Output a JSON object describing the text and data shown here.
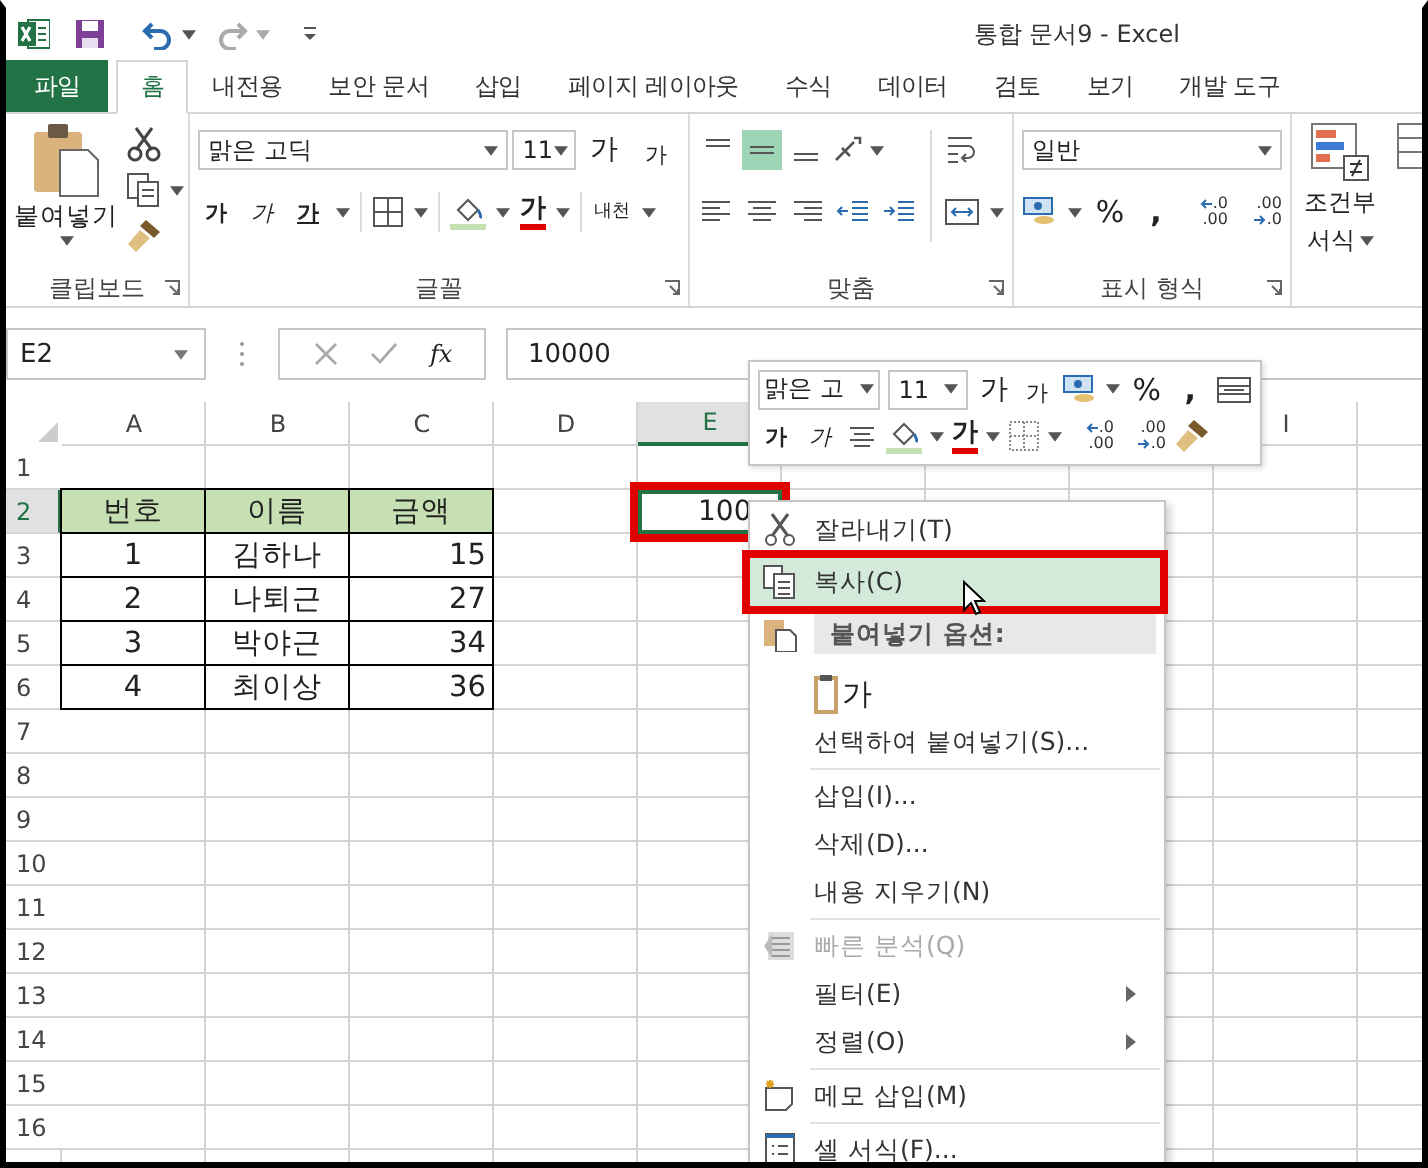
{
  "window": {
    "title": "통합 문서9 - Excel"
  },
  "tabs": [
    {
      "label": "파일",
      "kind": "file",
      "selected": false
    },
    {
      "label": "홈",
      "kind": "tab",
      "selected": true
    },
    {
      "label": "내전용",
      "kind": "tab",
      "selected": false
    },
    {
      "label": "보안 문서",
      "kind": "tab",
      "selected": false
    },
    {
      "label": "삽입",
      "kind": "tab",
      "selected": false
    },
    {
      "label": "페이지 레이아웃",
      "kind": "tab",
      "selected": false
    },
    {
      "label": "수식",
      "kind": "tab",
      "selected": false
    },
    {
      "label": "데이터",
      "kind": "tab",
      "selected": false
    },
    {
      "label": "검토",
      "kind": "tab",
      "selected": false
    },
    {
      "label": "보기",
      "kind": "tab",
      "selected": false
    },
    {
      "label": "개발 도구",
      "kind": "tab",
      "selected": false
    }
  ],
  "ribbon": {
    "clipboard": {
      "label": "클립보드",
      "paste": "붙여넣기"
    },
    "font": {
      "label": "글꼴",
      "font_name": "맑은 고딕",
      "font_size": "11",
      "size_buttons": [
        {
          "label": "가",
          "kind": "grow"
        },
        {
          "label": "가",
          "kind": "shrink"
        }
      ],
      "style_buttons": [
        {
          "label": "가",
          "kind": "bold"
        },
        {
          "label": "가",
          "kind": "italic"
        },
        {
          "label": "가",
          "kind": "underline"
        }
      ],
      "font_color": "가",
      "phonetic": "내천"
    },
    "alignment": {
      "label": "맞춤",
      "vertical": [
        {
          "kind": "top",
          "selected": false
        },
        {
          "kind": "middle",
          "selected": true
        },
        {
          "kind": "bottom",
          "selected": false
        }
      ]
    },
    "number": {
      "label": "표시 형식",
      "format": "일반",
      "percent": "%",
      "comma": ",",
      "decimals": [
        {
          "kind": "increase",
          "top": ".0",
          "bottom": ".00"
        },
        {
          "kind": "decrease",
          "top": ".00",
          "bottom": ".0"
        }
      ]
    },
    "styles": {
      "conditional": [
        "조건부",
        "서식"
      ]
    }
  },
  "formula_bar": {
    "name_box": "E2",
    "fx": "fx",
    "value": "10000"
  },
  "sheet": {
    "columns": [
      {
        "label": "A",
        "selected": false
      },
      {
        "label": "B",
        "selected": false
      },
      {
        "label": "C",
        "selected": false
      },
      {
        "label": "D",
        "selected": false
      },
      {
        "label": "E",
        "selected": true
      },
      {
        "label": "I",
        "selected": false
      }
    ],
    "rows": [
      {
        "number": "1",
        "selected": false,
        "cells": []
      },
      {
        "number": "2",
        "selected": true,
        "active_value": "100",
        "cells": [
          {
            "text": "번호",
            "kind": "heading"
          },
          {
            "text": "이름",
            "kind": "heading"
          },
          {
            "text": "금액",
            "kind": "heading"
          }
        ]
      },
      {
        "number": "3",
        "selected": false,
        "cells": [
          {
            "text": "1",
            "kind": "index"
          },
          {
            "text": "김하나",
            "kind": "text"
          },
          {
            "text": "15",
            "kind": "number"
          }
        ]
      },
      {
        "number": "4",
        "selected": false,
        "cells": [
          {
            "text": "2",
            "kind": "index"
          },
          {
            "text": "나퇴근",
            "kind": "text"
          },
          {
            "text": "27",
            "kind": "number"
          }
        ]
      },
      {
        "number": "5",
        "selected": false,
        "cells": [
          {
            "text": "3",
            "kind": "index"
          },
          {
            "text": "박야근",
            "kind": "text"
          },
          {
            "text": "34",
            "kind": "number"
          }
        ]
      },
      {
        "number": "6",
        "selected": false,
        "cells": [
          {
            "text": "4",
            "kind": "index"
          },
          {
            "text": "최이상",
            "kind": "text"
          },
          {
            "text": "36",
            "kind": "number"
          }
        ]
      },
      {
        "number": "7",
        "selected": false,
        "cells": []
      },
      {
        "number": "8",
        "selected": false,
        "cells": []
      },
      {
        "number": "9",
        "selected": false,
        "cells": []
      },
      {
        "number": "10",
        "selected": false,
        "cells": []
      },
      {
        "number": "11",
        "selected": false,
        "cells": []
      },
      {
        "number": "12",
        "selected": false,
        "cells": []
      },
      {
        "number": "13",
        "selected": false,
        "cells": []
      },
      {
        "number": "14",
        "selected": false,
        "cells": []
      },
      {
        "number": "15",
        "selected": false,
        "cells": []
      },
      {
        "number": "16",
        "selected": false,
        "cells": []
      }
    ]
  },
  "mini_toolbar": {
    "font_name": "맑은 고",
    "font_size": "11",
    "size_buttons": [
      {
        "label": "가",
        "kind": "grow"
      },
      {
        "label": "가",
        "kind": "shrink"
      }
    ],
    "percent": "%",
    "comma": ",",
    "style_buttons": [
      {
        "label": "가",
        "kind": "bold"
      },
      {
        "label": "가",
        "kind": "italic"
      }
    ],
    "font_color": "가",
    "decimals": [
      {
        "kind": "increase",
        "top": ".0",
        "bottom": ".00"
      },
      {
        "kind": "decrease",
        "top": ".00",
        "bottom": ".0"
      }
    ]
  },
  "context_menu": [
    {
      "kind": "cut",
      "label": "잘라내기(T)",
      "selected": false,
      "disabled": false
    },
    {
      "kind": "copy",
      "label": "복사(C)",
      "selected": true,
      "disabled": false
    },
    {
      "kind": "section",
      "label": "붙여넣기 옵션:"
    },
    {
      "kind": "paste",
      "label": "가"
    },
    {
      "kind": "item",
      "label": "선택하여 붙여넣기(S)...",
      "selected": false,
      "disabled": false
    },
    {
      "kind": "separator"
    },
    {
      "kind": "item",
      "label": "삽입(I)...",
      "selected": false,
      "disabled": false
    },
    {
      "kind": "item",
      "label": "삭제(D)...",
      "selected": false,
      "disabled": false
    },
    {
      "kind": "item",
      "label": "내용 지우기(N)",
      "selected": false,
      "disabled": false
    },
    {
      "kind": "separator"
    },
    {
      "kind": "analysis",
      "label": "빠른 분석(Q)",
      "selected": false,
      "disabled": true
    },
    {
      "kind": "submenu",
      "label": "필터(E)",
      "selected": false,
      "disabled": false
    },
    {
      "kind": "submenu",
      "label": "정렬(O)",
      "selected": false,
      "disabled": false
    },
    {
      "kind": "separator"
    },
    {
      "kind": "comment",
      "label": "메모 삽입(M)",
      "selected": false,
      "disabled": false
    },
    {
      "kind": "separator"
    },
    {
      "kind": "format",
      "label": "셀 서식(F)...",
      "selected": false,
      "disabled": false
    }
  ]
}
